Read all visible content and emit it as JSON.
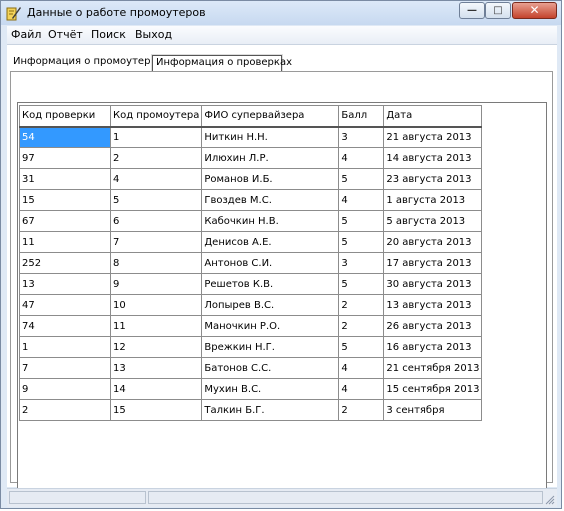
{
  "window": {
    "title": "Данные о работе промоутеров"
  },
  "menu": {
    "items": [
      "Файл",
      "Отчёт",
      "Поиск",
      "Выход"
    ]
  },
  "tabs": [
    {
      "label": "Информация о промоутерах",
      "active": false
    },
    {
      "label": "Информация о проверках",
      "active": true
    }
  ],
  "table": {
    "headers": [
      "Код проверки",
      "Код промоутера",
      "ФИО супервайзера",
      "Балл",
      "Дата"
    ],
    "rows": [
      [
        "54",
        "1",
        "Ниткин Н.Н.",
        "3",
        "21 августа 2013"
      ],
      [
        "97",
        "2",
        "Илюхин Л.Р.",
        "4",
        "14 августа 2013"
      ],
      [
        "31",
        "4",
        "Романов И.Б.",
        "5",
        "23 августа 2013"
      ],
      [
        "15",
        "5",
        "Гвоздев М.С.",
        "4",
        "1 августа 2013"
      ],
      [
        "67",
        "6",
        "Кабочкин Н.В.",
        "5",
        "5 августа 2013"
      ],
      [
        "11",
        "7",
        "Денисов А.Е.",
        "5",
        "20 августа 2013"
      ],
      [
        "252",
        "8",
        "Антонов С.И.",
        "3",
        "17 августа 2013"
      ],
      [
        "13",
        "9",
        "Решетов К.В.",
        "5",
        "30 августа 2013"
      ],
      [
        "47",
        "10",
        "Лопырев В.С.",
        "2",
        "13 августа 2013"
      ],
      [
        "74",
        "11",
        "Маночкин Р.О.",
        "2",
        "26 августа 2013"
      ],
      [
        "1",
        "12",
        "Врежкин Н.Г.",
        "5",
        "16 августа 2013"
      ],
      [
        "7",
        "13",
        "Батонов С.С.",
        "4",
        "21 сентября 2013"
      ],
      [
        "9",
        "14",
        "Мухин В.С.",
        "4",
        "15 сентября 2013"
      ],
      [
        "2",
        "15",
        "Талкин Б.Г.",
        "2",
        "3 сентября"
      ]
    ]
  },
  "colors": {
    "selection": "#3399ff",
    "title_bar": "#dce9f8",
    "close_button": "#c4432c"
  }
}
